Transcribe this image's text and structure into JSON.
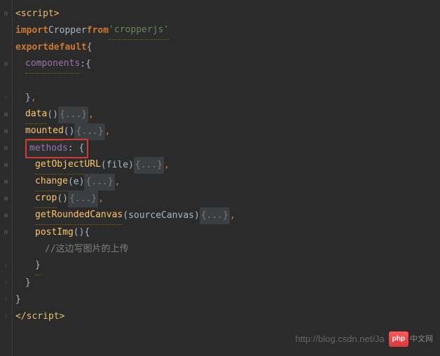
{
  "code": {
    "script_open": "<script>",
    "script_close": "</script>",
    "import_kw": "import",
    "import_name": "Cropper",
    "from_kw": "from",
    "import_source": "'cropperjs'",
    "export_kw": "export",
    "default_kw": "default",
    "brace_open": "{",
    "brace_close": "}",
    "components_key": "components",
    "data_key": "data",
    "mounted_key": "mounted",
    "methods_key": "methods",
    "getObjectURL": "getObjectURL",
    "file_param": "file",
    "change_fn": "change",
    "e_param": "e",
    "crop_fn": "crop",
    "getRoundedCanvas": "getRoundedCanvas",
    "sourceCanvas_param": "sourceCanvas",
    "postImg_fn": "postImg",
    "folded": "{...}",
    "comment_upload": "//这边写图片的上传",
    "colon": ":",
    "comma": ",",
    "paren_open": "(",
    "paren_close": ")",
    "empty_parens": "()"
  },
  "gutter": {
    "collapse": "⊟",
    "expand": "⊞",
    "down": "⌄",
    "up": "˄"
  },
  "watermark": {
    "url": "http://blog.csdn.net/Ja",
    "logo": "php",
    "suffix": "中文网"
  }
}
